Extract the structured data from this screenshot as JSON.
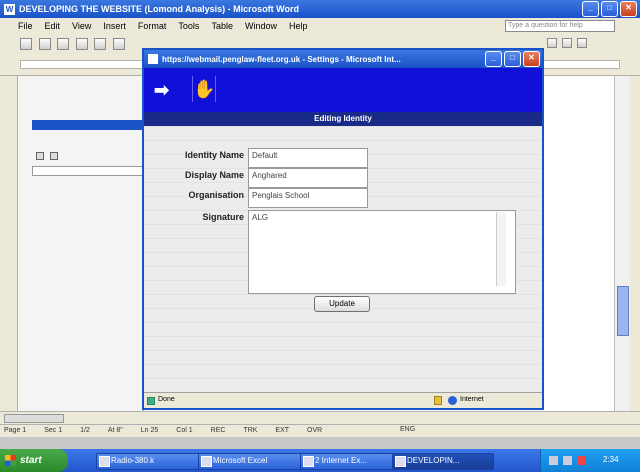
{
  "word": {
    "title": "DEVELOPING THE WEBSITE (Lomond Analysis) - Microsoft Word",
    "menu": [
      "File",
      "Edit",
      "View",
      "Insert",
      "Format",
      "Tools",
      "Table",
      "Window",
      "Help"
    ],
    "help_placeholder": "Type a question for help",
    "status": [
      "Page 1",
      "Sec 1",
      "1/2",
      "At 8\"",
      "Ln 25",
      "Col 1",
      "REC",
      "TRK",
      "EXT",
      "OVR"
    ],
    "status_lang": "ENG"
  },
  "browser": {
    "title": "https://webmail.penglaw-fleet.org.uk - Settings - Microsoft Int...",
    "header": "Editing Identity",
    "fields": [
      {
        "label": "Identity Name",
        "value": "Default"
      },
      {
        "label": "Display Name",
        "value": "Anghared"
      },
      {
        "label": "Organisation",
        "value": "Penglais School"
      }
    ],
    "signature_label": "Signature",
    "signature_value": "ALG",
    "update_label": "Update",
    "status_left": "Done",
    "status_zone": "Internet"
  },
  "taskbar": {
    "start": "start",
    "items": [
      "Radio-380.k",
      "Microsoft Excel",
      "2 Internet Ex...",
      "DEVELOPIN..."
    ],
    "clock": "2:34"
  },
  "colors": {
    "xp_blue": "#1a52c8",
    "toolbar_blue": "#1010d8",
    "start_green": "#3a9a3a"
  }
}
